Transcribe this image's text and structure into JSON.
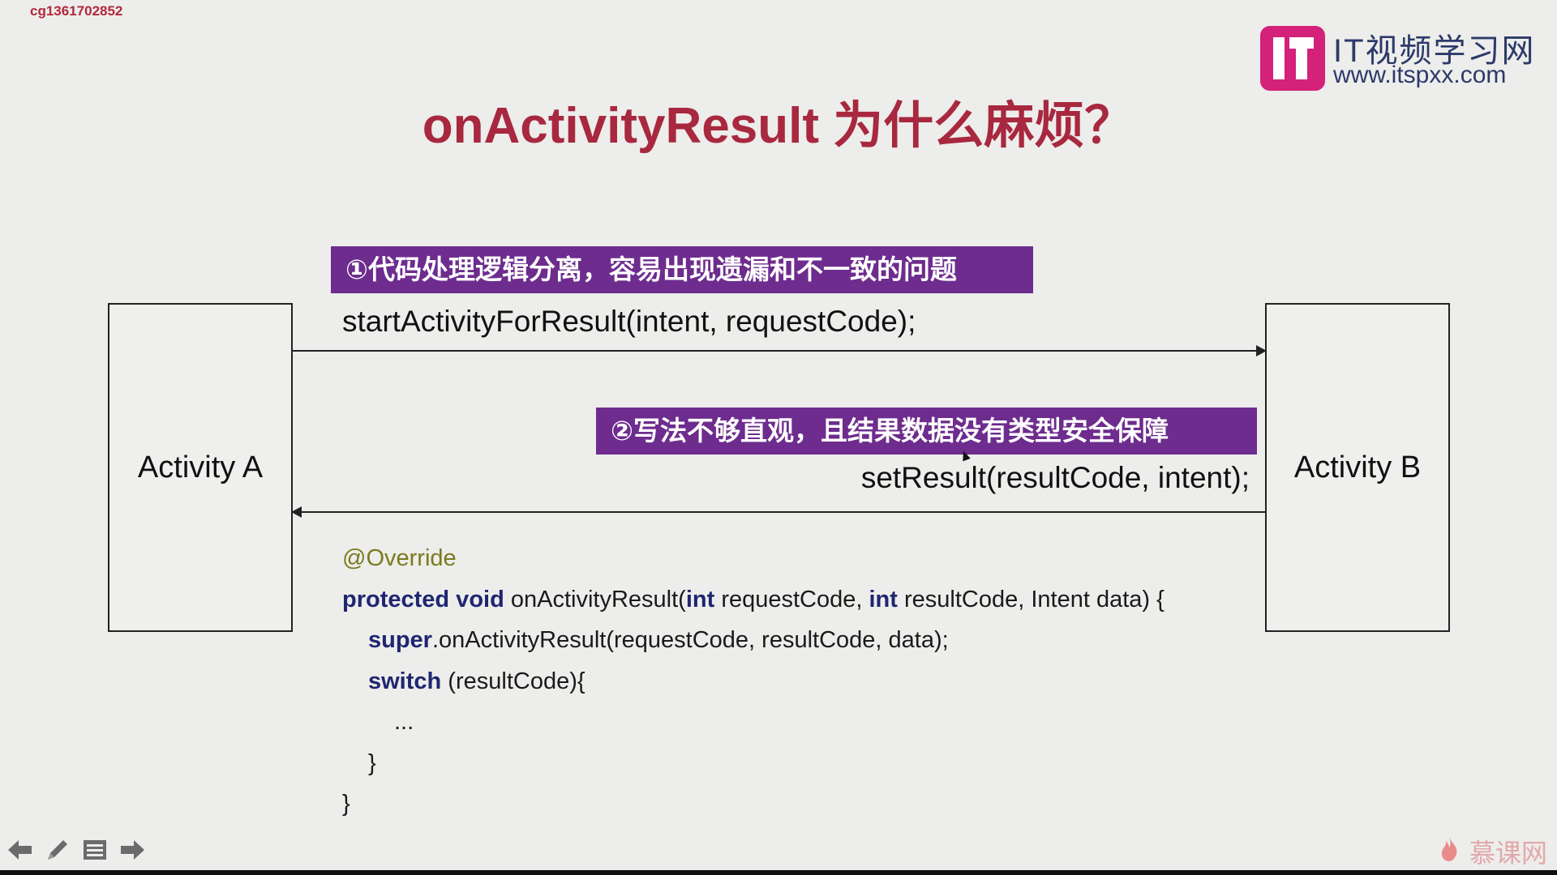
{
  "header": {
    "user_id": "cg1361702852",
    "logo": {
      "icon": "it-logo-icon",
      "name": "IT视频学习网",
      "url": "www.itspxx.com",
      "brand_color": "#d4217a"
    }
  },
  "slide": {
    "title": "onActivityResult 为什么麻烦？",
    "title_color": "#a8283f",
    "activity_a": "Activity A",
    "activity_b": "Activity B",
    "callout_1": "①代码处理逻辑分离，容易出现遗漏和不一致的问题",
    "callout_2": "②写法不够直观，且结果数据没有类型安全保障",
    "callout_color": "#6d2c8e",
    "start_call": "startActivityForResult(intent, requestCode);",
    "set_result": "setResult(resultCode, intent);",
    "code": {
      "annotation": "@Override",
      "l2_kw": "protected void",
      "l2_a": " onActivityResult(",
      "l2_kw2": "int",
      "l2_b": " requestCode, ",
      "l2_kw3": "int",
      "l2_c": " resultCode, Intent data) {",
      "l3_kw": "super",
      "l3_rest": ".onActivityResult(requestCode, resultCode, data);",
      "l4_kw": "switch",
      "l4_rest": " (resultCode){",
      "l5": "...",
      "l6": "}",
      "l7": "}"
    }
  },
  "controls": {
    "prev_icon": "arrow-left-icon",
    "pen_icon": "pen-icon",
    "menu_icon": "menu-icon",
    "next_icon": "arrow-right-icon"
  },
  "watermark": {
    "icon": "flame-icon",
    "text": "慕课网"
  }
}
